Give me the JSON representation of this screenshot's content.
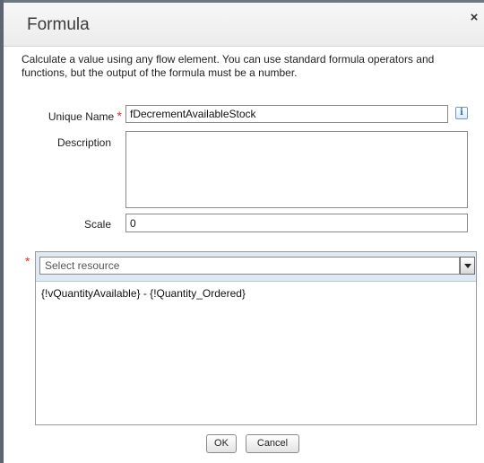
{
  "dialog": {
    "title": "Formula",
    "close_glyph": "×",
    "description": "Calculate a value using any flow element. You can use standard formula operators and functions, but the output of the formula must be a number."
  },
  "form": {
    "unique_name_label": "Unique Name",
    "required_marker": "*",
    "unique_name_value": "fDecrementAvailableStock",
    "info_icon_glyph": "i",
    "description_label": "Description",
    "description_value": "",
    "scale_label": "Scale",
    "scale_value": "0"
  },
  "resource": {
    "required_marker": "*",
    "select_placeholder": "Select resource",
    "formula_value": "{!vQuantityAvailable} - {!Quantity_Ordered}"
  },
  "buttons": {
    "ok_label": "OK",
    "cancel_label": "Cancel"
  },
  "colors": {
    "required": "#d9342b",
    "header_band": "#dfe9f3",
    "info_icon": "#2f6fb0"
  },
  "icons": {
    "close": "close-icon",
    "info": "info-icon",
    "dropdown": "chevron-down-icon"
  }
}
